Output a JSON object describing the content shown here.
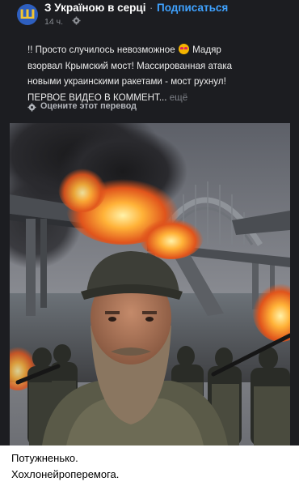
{
  "post": {
    "channel_name": "З Україною в серці",
    "separator": "·",
    "subscribe_label": "Подписаться",
    "time": "14 ч.",
    "message_lines": [
      "!! Просто случилось невозможное",
      "Мадяр",
      "взорвал Крымский мост! Массированная атака",
      "новыми украинскими ракетами - мост рухнул!",
      "ПЕРВОЕ ВИДЕО В КОММЕНТ...",
      "ещё"
    ],
    "translate_label": "Оцените этот перевод"
  },
  "caption": {
    "lines": [
      "Потужненько.",
      "Хохлонейроперемога."
    ]
  },
  "colors": {
    "post_background": "#1c1d21",
    "link": "#3fa2ff",
    "text": "#ececec",
    "muted": "#8a8d93"
  },
  "icons": [
    "channel-avatar-icon",
    "gear-icon",
    "emoji-star-eyes-icon",
    "gear-icon"
  ]
}
